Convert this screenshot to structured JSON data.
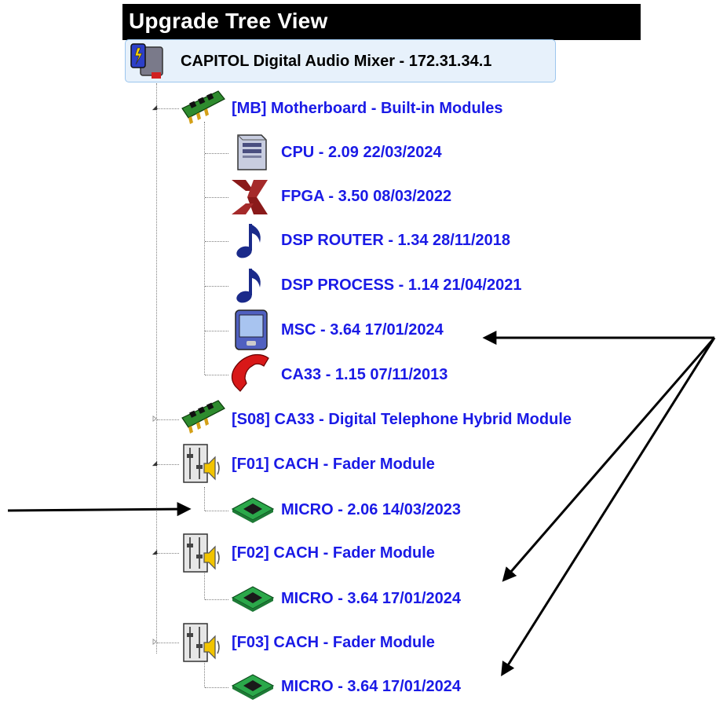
{
  "panel": {
    "title": "Upgrade Tree View"
  },
  "root": {
    "label": "CAPITOL Digital Audio Mixer - 172.31.34.1",
    "icon": "mixer-device-icon"
  },
  "nodes": [
    {
      "label": "[MB] Motherboard - Built-in Modules",
      "icon": "circuit-board-icon",
      "expanded": true,
      "children": [
        {
          "label": "CPU - 2.09 22/03/2024",
          "icon": "computer-tower-icon"
        },
        {
          "label": "FPGA - 3.50 08/03/2022",
          "icon": "xilinx-logo-icon"
        },
        {
          "label": "DSP ROUTER - 1.34 28/11/2018",
          "icon": "music-note-icon"
        },
        {
          "label": "DSP PROCESS - 1.14 21/04/2021",
          "icon": "music-note-icon"
        },
        {
          "label": "MSC - 3.64 17/01/2024",
          "icon": "pda-device-icon"
        },
        {
          "label": "CA33 - 1.15 07/11/2013",
          "icon": "telephone-handset-icon"
        }
      ]
    },
    {
      "label": "[S08] CA33 - Digital Telephone Hybrid Module",
      "icon": "circuit-board-icon",
      "expanded": false,
      "children": []
    },
    {
      "label": "[F01] CACH - Fader Module",
      "icon": "fader-speaker-icon",
      "expanded": true,
      "children": [
        {
          "label": "MICRO - 2.06 14/03/2023",
          "icon": "microchip-icon"
        }
      ]
    },
    {
      "label": "[F02] CACH - Fader Module",
      "icon": "fader-speaker-icon",
      "expanded": true,
      "children": [
        {
          "label": "MICRO - 3.64 17/01/2024",
          "icon": "microchip-icon"
        }
      ]
    },
    {
      "label": "[F03] CACH - Fader Module",
      "icon": "fader-speaker-icon",
      "expanded": false,
      "children": [
        {
          "label": "MICRO - 3.64 17/01/2024",
          "icon": "microchip-icon"
        }
      ]
    }
  ],
  "colors": {
    "node_text": "#1a1ae6",
    "root_text": "#000000",
    "selection_bg": "#e7f1fb",
    "selection_border": "#9cc6ee",
    "title_bg": "#000000",
    "title_text": "#ffffff"
  }
}
